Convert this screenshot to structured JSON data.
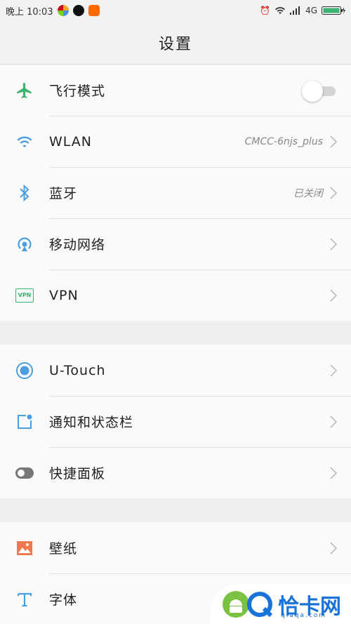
{
  "status_bar": {
    "time": "晚上 10:03",
    "network": "4G",
    "colors": {
      "browser": "#f5a623",
      "qq": "#111111",
      "shop": "#ff6a00"
    }
  },
  "header": {
    "title": "设置"
  },
  "groups": [
    {
      "items": [
        {
          "icon": "airplane-icon",
          "label": "飞行模式",
          "type": "toggle",
          "enabled": false,
          "icon_color": "#3cb371"
        },
        {
          "icon": "wifi-icon",
          "label": "WLAN",
          "value": "CMCC-6njs_plus",
          "type": "nav",
          "icon_color": "#4a9fe0"
        },
        {
          "icon": "bluetooth-icon",
          "label": "蓝牙",
          "value": "已关闭",
          "type": "nav",
          "icon_color": "#4a9fe0"
        },
        {
          "icon": "mobile-network-icon",
          "label": "移动网络",
          "type": "nav",
          "icon_color": "#4a9fe0"
        },
        {
          "icon": "vpn-icon",
          "label": "VPN",
          "icon_text": "VPN",
          "type": "nav",
          "icon_color": "#3cb371"
        }
      ]
    },
    {
      "items": [
        {
          "icon": "u-touch-icon",
          "label": "U-Touch",
          "type": "nav",
          "icon_color": "#4a9fe0"
        },
        {
          "icon": "notification-icon",
          "label": "通知和状态栏",
          "type": "nav",
          "icon_color": "#4a9fe0"
        },
        {
          "icon": "quick-panel-icon",
          "label": "快捷面板",
          "type": "nav",
          "icon_color": "#777777"
        }
      ]
    },
    {
      "items": [
        {
          "icon": "wallpaper-icon",
          "label": "壁纸",
          "type": "nav",
          "icon_color": "#f07850"
        },
        {
          "icon": "font-icon",
          "label": "字体",
          "type": "nav",
          "icon_color": "#4a9fe0"
        }
      ]
    }
  ],
  "watermark": {
    "brand": "恰卡网",
    "domain": "qiaqa.com"
  }
}
